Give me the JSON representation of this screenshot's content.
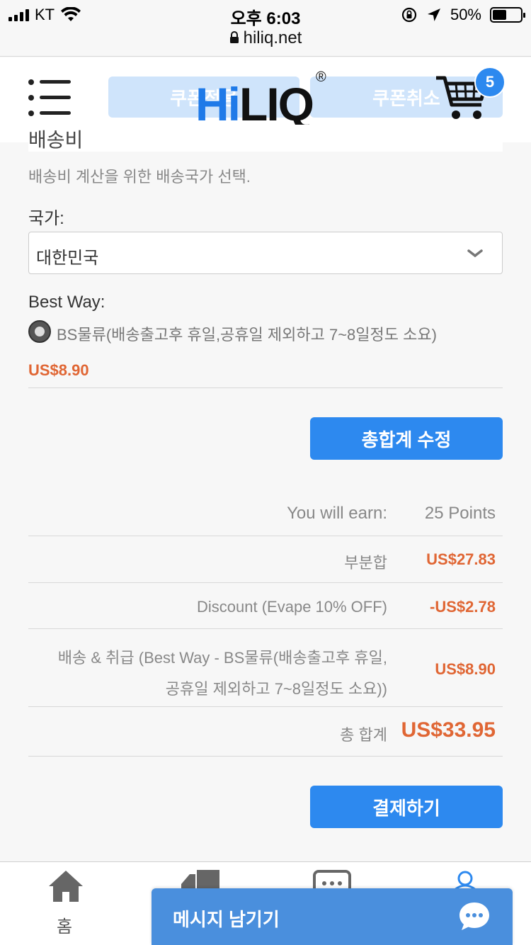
{
  "status_bar": {
    "carrier": "KT",
    "time": "오후 6:03",
    "url": "hiliq.net",
    "battery": "50%",
    "battery_level": 0.5
  },
  "header": {
    "coupon_apply": "쿠폰적용",
    "coupon_cancel": "쿠폰취소",
    "logo_hi": "Hi",
    "logo_liq": "LIQ",
    "logo_reg": "®",
    "cart_count": "5"
  },
  "shipping": {
    "section_title": "배송비",
    "hint": "배송비 계산을 위한 배송국가 선택.",
    "country_label": "국가:",
    "country_value": "대한민국",
    "method_label": "Best Way:",
    "option_label": "BS물류(배송출고후 휴일,공휴일 제외하고 7~8일정도 소요)",
    "option_price": "US$8.90",
    "update_button": "총합계 수정"
  },
  "totals": {
    "earn_label": "You will earn:",
    "earn_value": "25 Points",
    "subtotal_label": "부분합",
    "subtotal_value": "US$27.83",
    "discount_label": "Discount (Evape 10% OFF)",
    "discount_value": "-US$2.78",
    "shipping_label_line1": "배송 & 취급 (Best Way - BS물류(배송출고후 휴일,",
    "shipping_label_line2": "공휴일 제외하고 7~8일정도 소요))",
    "shipping_value": "US$8.90",
    "grand_label": "총 합계",
    "grand_value": "US$33.95"
  },
  "checkout_button": "결제하기",
  "bottom_nav": {
    "home_label": "홈",
    "message_label": "메시지 남기기"
  },
  "colors": {
    "accent": "#2d89ef",
    "price": "#e06634"
  }
}
